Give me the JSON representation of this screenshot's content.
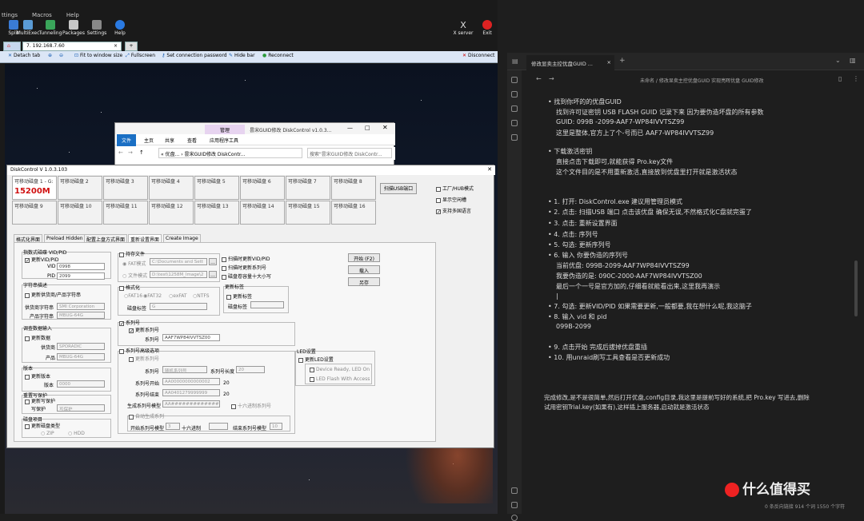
{
  "moba": {
    "menu": [
      "ttings",
      "Macros",
      "Help"
    ],
    "tools": [
      {
        "label": "Split",
        "color": "#3a7bd5"
      },
      {
        "label": "MultiExec",
        "color": "#5a9bd5"
      },
      {
        "label": "Tunneling",
        "color": "#3aa55a"
      },
      {
        "label": "Packages",
        "color": "#c8c8c8"
      },
      {
        "label": "Settings",
        "color": "#888"
      },
      {
        "label": "Help",
        "color": "#2a7ae2"
      }
    ],
    "right_tools": [
      "X server",
      "Exit"
    ],
    "tab_label": "7. 192.168.7.60",
    "rdp": [
      "Detach tab",
      "Fit to window size",
      "Fullscreen",
      "Set connection password",
      "Hide bar",
      "Reconnect",
      "Disconnect"
    ]
  },
  "explorer": {
    "title": "昙宋GUID修改 DiskControl v1.0.3...",
    "manage": "管理",
    "ribbon": [
      "文件",
      "主页",
      "共享",
      "查看",
      "应用程序工具"
    ],
    "path": "« 优盘... › 昙宋GUID修改 DiskContr...",
    "search": "搜索\"昙宋GUID修改 DiskContr..."
  },
  "dc": {
    "title": "DiskControl V 1.0.3.103",
    "disks_row1": [
      "可移动磁盘 1 - G:",
      "可移动磁盘 2",
      "可移动磁盘 3",
      "可移动磁盘 4",
      "可移动磁盘 5",
      "可移动磁盘 6",
      "可移动磁盘 7",
      "可移动磁盘 8"
    ],
    "disks_row2": [
      "可移动磁盘 9",
      "可移动磁盘 10",
      "可移动磁盘 11",
      "可移动磁盘 12",
      "可移动磁盘 13",
      "可移动磁盘 14",
      "可移动磁盘 15",
      "可移动磁盘 16"
    ],
    "disk1_size": "15200M",
    "scan_btn": "扫描USB端口",
    "opts": [
      "工厂/HUB模式",
      "显示空闲槽",
      "支持多国语言"
    ],
    "tabs": [
      "格式化界面",
      "Preload Hidden",
      "配置上盘方式界面",
      "重新设置界面",
      "Create Image"
    ],
    "vidpid": {
      "group": "指数式磁碟 VID/PID",
      "chk": "更新VID/PID",
      "vid_l": "VID",
      "vid": "0998",
      "pid_l": "PID",
      "pid": "2099"
    },
    "strdesc": {
      "group": "字符串描述",
      "chk": "更新供货商/产品字符串",
      "vendor_l": "供货商字符串",
      "vendor": "SMI Corporation",
      "product_l": "产品字符串",
      "product": "MBUG-64G"
    },
    "query": {
      "group": "调查数据输入",
      "chk": "更新数据",
      "vendor_l": "供货商",
      "vendor": "SPORADIC",
      "product_l": "产品",
      "product": "MBUG-64G"
    },
    "version": {
      "group": "版本",
      "chk": "更新版本",
      "ver_l": "版本",
      "ver": "0000"
    },
    "wp": {
      "group": "重置写保护",
      "chk": "更新写保护",
      "wp_l": "写保护",
      "wp": "写保护"
    },
    "disktype": {
      "group": "磁盘项目",
      "chk": "更新磁盘类型",
      "zip": "ZIP",
      "hdd": "HDD"
    },
    "image": {
      "chk": "持存文件",
      "fat": "FAT模式",
      "fat_path": "C:\\Documents and Sett",
      "file": "文件模式",
      "file_path": "D:\\test\\1258M_Image\\2"
    },
    "format": {
      "chk": "格式化",
      "f1": "FAT16",
      "f2": "FAT32",
      "f3": "exFAT",
      "f4": "NTFS",
      "label_l": "磁盘标签",
      "label": "G"
    },
    "mid": {
      "o1": "扫描时更新VID/PID",
      "o2": "扫描时更新系列号",
      "o3": "磁盘卷容量十大小写",
      "grp": "更新标签",
      "chk": "更新标签",
      "label_l": "磁盘标签"
    },
    "buttons": [
      "开始 (F2)",
      "载入",
      "另存"
    ],
    "serial": {
      "chk": "系列号",
      "chk2": "更新系列号",
      "sn_l": "系列号",
      "sn": "AAF7WP84IVVTSZ00"
    },
    "adv": {
      "chk": "系列号高级选项",
      "chk2": "更新系列号",
      "sn_l": "系列号",
      "sn": "随机系列号",
      "len_l": "系列号长度",
      "len": "20",
      "start_l": "系列号开始",
      "start": "AA00000000000002",
      "end_l": "系列号结束",
      "end": "AA0401279999999",
      "n1": "20",
      "n2": "20",
      "mask_l": "生成系列号模型",
      "mask": "AA###############",
      "hex": "十六进制系列号",
      "auto": "自动生成系列",
      "startm_l": "开始系列号模型",
      "startm": "3",
      "dec": "十六进制",
      "endm_l": "结束系列号模型",
      "endm": "10"
    },
    "led": {
      "group": "LED设置",
      "chk": "更新LED设置",
      "o1": "Device Ready, LED On",
      "o2": "LED Flash With Access"
    }
  },
  "obs": {
    "tab": "修改显卖主控优盘GUID ...",
    "crumb": "未命名 / 修改显卖主控优盘GUID 实现亮晖优盘 GUID修改",
    "lines": [
      "找到你坏的的优盘GUID",
      "找到许可证密钥 USB FLASH GUID 记录下来 因为要伪造坏盘的所有参数",
      "GUID: 099B -2099-AAF7-WP84IVVTSZ99",
      "这里是整体,官方上了个-号而已  AAF7-WP84IVVTSZ99",
      "下载激活密钥",
      "直接点击下载即可,就能获得 Pro.key文件",
      "这个文件目的是不用重新激活,直接放到优盘里打开就是激活状态",
      "1. 打开: DiskControl.exe  建议用管理员模式",
      "2. 点击: 扫描USB 端口  点击该优盘 确保无误,不然格式化C盘就完蛋了",
      "3. 点击: 重新设置界面",
      "4. 点击: 序列号",
      "5. 勾选: 更新序列号",
      "6. 输入 你要伪造的序列号",
      "当前优盘: 099B-2099-AAF7WP84IVVTSZ99",
      "我要伪造的是: 090C-2000-AAF7WP84IVVTSZ00",
      "最后一个一号是官方加的,仔细看就能看出来,这里我再演示",
      "|",
      "7. 勾选: 更新VID/PID  如果需要更新,一般都要,我在想什么呢,我这脑子",
      "8. 输入 vid 和 pid",
      "099B-2099",
      "9. 点击开始 完成后拔掉优盘重插",
      "10. 用unraid刷写工具查看是否更新成功",
      "完成修改,是不是很简单,然后打开优盘,config目录,我这里是提前写好的系统,把 Pro.key 写进去,删除",
      "试用密钥Trial.key(如果有),这样插上服务器,启动就是激活状态"
    ],
    "status": "0 条反向链接    914 个词    1550 个字符",
    "watermark": "什么值得买"
  }
}
